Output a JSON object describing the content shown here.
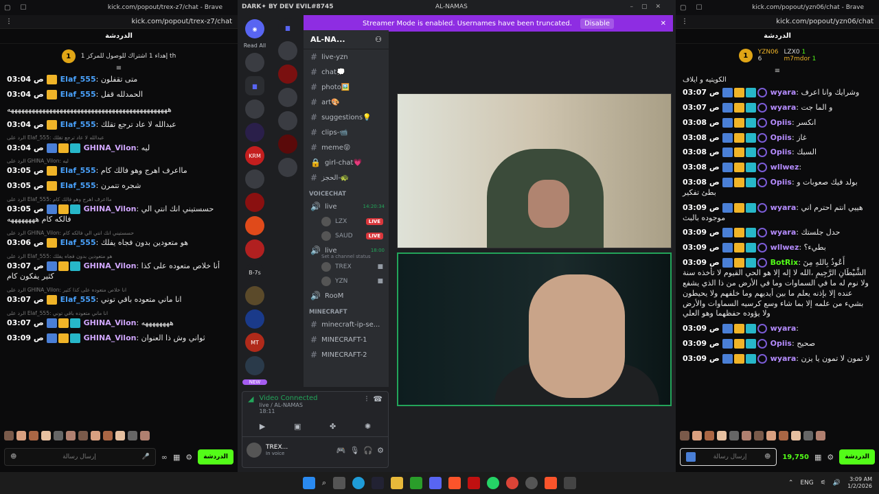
{
  "left": {
    "tab_title": "kick.com/popout/trex-z7/chat - Brave",
    "url": "kick.com/popout/trex-z7/chat",
    "chat_header": "الدردشة",
    "pinned": "إهداء 1 اشتراك للوصول للمركز 1 th",
    "pinned_coin": "1",
    "messages": [
      {
        "reply": "",
        "time": "03:04 ص",
        "user": "Elaf_555",
        "ucolor": "#4aa3ff",
        "text": "متى تقفلون",
        "badges": [
          "gold"
        ]
      },
      {
        "reply": "",
        "time": "03:04 ص",
        "user": "Elaf_555",
        "ucolor": "#4aa3ff",
        "text": "الحمدلله قفل",
        "badges": [
          "gold"
        ]
      },
      {
        "reply": "",
        "time": "",
        "user": "",
        "ucolor": "#fff",
        "text": "ههههههههههههههههههههههههههههههههههههههههههههههه",
        "badges": []
      },
      {
        "reply": "",
        "time": "03:04 ص",
        "user": "Elaf_555",
        "ucolor": "#4aa3ff",
        "text": "عبدالله لا عاد ترجع تقلك",
        "badges": [
          "gold"
        ]
      },
      {
        "reply": "الرد على Elaf_555: عبدالله لا عاد ترجع تقلك",
        "time": "03:04 ص",
        "user": "GHINA_Vilon",
        "ucolor": "#d1a7ff",
        "text": "ليه",
        "badges": [
          "blue",
          "gold",
          "cyan"
        ]
      },
      {
        "reply": "الرد على GHINA_Vilon: ليه",
        "time": "03:05 ص",
        "user": "Elaf_555",
        "ucolor": "#4aa3ff",
        "text": "مااعرف اهرج وهو فالك كام",
        "badges": [
          "gold"
        ]
      },
      {
        "reply": "",
        "time": "03:05 ص",
        "user": "Elaf_555",
        "ucolor": "#4aa3ff",
        "text": "شجره تتمرن",
        "badges": [
          "gold"
        ]
      },
      {
        "reply": "الرد على Elaf_555: مااعرف اهرج وهو فالك كام",
        "time": "03:05 ص",
        "user": "GHINA_Vilon",
        "ucolor": "#d1a7ff",
        "text": "حسستيني انك انتي الي فالكه كام ههههههههه",
        "badges": [
          "blue",
          "gold",
          "cyan"
        ]
      },
      {
        "reply": "الرد على GHINA_Vilon: حسستيني انك انتي الي فالكه كام",
        "time": "03:06 ص",
        "user": "Elaf_555",
        "ucolor": "#4aa3ff",
        "text": "هو متعودين بدون فجاه يفلك",
        "badges": [
          "gold"
        ]
      },
      {
        "reply": "الرد على Elaf_555: هو متعودين بدون فجاه يفلك",
        "time": "03:07 ص",
        "user": "GHINA_Vilon",
        "ucolor": "#d1a7ff",
        "text": "أنا خلاص متعوده على كذا كثير يفكون كام",
        "badges": [
          "blue",
          "gold",
          "cyan"
        ]
      },
      {
        "reply": "الرد على GHINA_Vilon: انا خلاص متعوده على كذا كثير",
        "time": "03:07 ص",
        "user": "Elaf_555",
        "ucolor": "#4aa3ff",
        "text": "انا ماني متعوده باقي توني",
        "badges": [
          "gold"
        ]
      },
      {
        "reply": "الرد على Elaf_555: انا ماني متعوده باقي توني",
        "time": "03:07 ص",
        "user": "GHINA_Vilon",
        "ucolor": "#d1a7ff",
        "text": "ههههههههه",
        "badges": [
          "blue",
          "gold",
          "cyan"
        ]
      },
      {
        "reply": "",
        "time": "03:09 ص",
        "user": "GHINA_Vilon",
        "ucolor": "#d1a7ff",
        "text": "ثواني وش ذا العنوان",
        "badges": [
          "blue",
          "gold",
          "cyan"
        ]
      }
    ],
    "input_placeholder": "إرسال رسالة",
    "send_label": "الدردشة"
  },
  "discord": {
    "brand": "DARK✦ BY DEV EVIL#8745",
    "window_title": "AL-NAMAS",
    "banner_text": "Streamer Mode is enabled. Usernames have been truncated.",
    "disable_label": "Disable",
    "read_all": "Read All",
    "server_name": "AL-NA...",
    "channels": [
      {
        "name": "live-yzn",
        "icon": "#"
      },
      {
        "name": "chat💭",
        "icon": "#"
      },
      {
        "name": "photo🖼️",
        "icon": "#"
      },
      {
        "name": "art🎨",
        "icon": "#"
      },
      {
        "name": "suggestions💡",
        "icon": "#"
      },
      {
        "name": "clips-📹",
        "icon": "#"
      },
      {
        "name": "meme😝",
        "icon": "#"
      },
      {
        "name": "girl-chat💗",
        "icon": "🔒"
      },
      {
        "name": "الحجز-🐢",
        "icon": "#"
      }
    ],
    "voicechat_label": "VOICECHAT",
    "voice_channels": [
      {
        "name": "live",
        "time": "14:20:34",
        "status": "",
        "users": [
          {
            "name": "LZX",
            "live": "LIVE"
          },
          {
            "name": "SAUD",
            "live": "LIVE"
          }
        ]
      },
      {
        "name": "live",
        "time": "18:00",
        "status": "Set a channel status",
        "users": [
          {
            "name": "TREX",
            "live": ""
          },
          {
            "name": "YZN",
            "live": ""
          }
        ]
      },
      {
        "name": "RooM",
        "time": "",
        "status": "",
        "users": []
      }
    ],
    "minecraft_label": "MINECRAFT",
    "minecraft_channels": [
      "minecraft-ip-se...",
      "MINECRAFT-1",
      "MINECRAFT-2"
    ],
    "guild_labels": [
      "B-7s",
      "NEW"
    ],
    "voice_connected": "Video Connected",
    "voice_channel_path": "live / AL-NAMAS",
    "voice_time": "18:11",
    "self_name": "TREX...",
    "self_status": "In voice"
  },
  "right": {
    "tab_title": "kick.com/popout/yzn06/chat - Brave",
    "url": "kick.com/popout/yzn06/chat",
    "chat_header": "الدردشة",
    "leaders": [
      {
        "name": "YZN06",
        "count": "6"
      },
      {
        "name": "LZX0",
        "count": "1"
      },
      {
        "name": "m7mdor",
        "count": "1"
      }
    ],
    "pinned_coin": "1",
    "top_text": "الكويتيه و ايلاف",
    "messages": [
      {
        "time": "03:07 ص",
        "user": "wyara",
        "ucolor": "#b58cff",
        "text": "وشرايك وانا اعرف"
      },
      {
        "time": "03:07 ص",
        "user": "wyara",
        "ucolor": "#b58cff",
        "text": "و الما جت"
      },
      {
        "time": "03:08 ص",
        "user": "Opiis",
        "ucolor": "#b58cff",
        "text": "انكسر"
      },
      {
        "time": "03:08 ص",
        "user": "Opiis",
        "ucolor": "#b58cff",
        "text": "غاز"
      },
      {
        "time": "03:08 ص",
        "user": "Opiis",
        "ucolor": "#b58cff",
        "text": "السبك"
      },
      {
        "time": "03:08 ص",
        "user": "wllwez",
        "ucolor": "#b58cff",
        "text": ""
      },
      {
        "time": "03:08 ص",
        "user": "Opiis",
        "ucolor": "#b58cff",
        "text": "بولد فيك صعوبات و بطئ تفكير"
      },
      {
        "time": "03:09 ص",
        "user": "wyara",
        "ucolor": "#b58cff",
        "text": "هييي انتم احترم اني موجوده بالبث"
      },
      {
        "time": "03:09 ص",
        "user": "wyara",
        "ucolor": "#b58cff",
        "text": "حدل جلستك"
      },
      {
        "time": "03:09 ص",
        "user": "wllwez",
        "ucolor": "#b58cff",
        "text": "بطيء؟"
      },
      {
        "time": "03:09 ص",
        "user": "BotRix",
        "ucolor": "#53fc18",
        "text": "أَعُوذُ بِاللهِ مِنَ الشَّيْطَانِ الرَّجِيمِ ،الله لا إله إلا هو الحي القيوم لا تأخذه سنة ولا نوم له ما في السماوات وما في الأرض من ذا الذي يشفع عنده إلا بإذنه يعلم ما بين أيديهم وما خلفهم ولا يحيطون بشيء من علمه إلا بما شاء وسع كرسيه السماوات والأرض ولا يؤوده حفظهما وهو العلي"
      },
      {
        "time": "03:09 ص",
        "user": "wyara",
        "ucolor": "#b58cff",
        "text": ""
      },
      {
        "time": "03:09 ص",
        "user": "Opiis",
        "ucolor": "#b58cff",
        "text": "صحيح"
      },
      {
        "time": "03:09 ص",
        "user": "wyara",
        "ucolor": "#b58cff",
        "text": "لا تمون لا تمون يا يزن"
      }
    ],
    "input_placeholder": "إرسال رسالة",
    "points": "19,750",
    "send_label": "الدردشة"
  },
  "taskbar": {
    "lang": "ENG",
    "time": "3:09 AM",
    "date": "1/2/2026"
  },
  "colors": {
    "kick_green": "#53fc18",
    "discord_purple": "#8e2de2",
    "voice_green": "#23a55a"
  }
}
